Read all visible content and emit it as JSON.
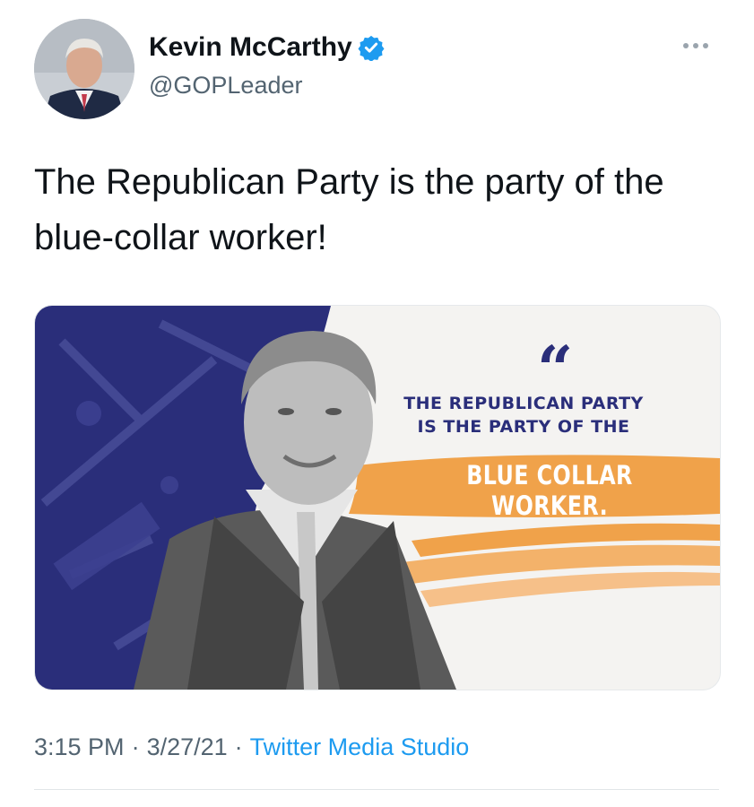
{
  "author": {
    "name": "Kevin McCarthy",
    "handle": "@GOPLeader",
    "verified_icon": "verified-badge-icon",
    "avatar_icon": "avatar-portrait"
  },
  "more_icon": "more-options-icon",
  "tweet": {
    "text": "The Republican Party is the party of the blue-collar worker!"
  },
  "media": {
    "quote_mark": "“",
    "line1": "THE REPUBLICAN PARTY",
    "line2": "IS THE PARTY OF THE",
    "highlight": "BLUE COLLAR WORKER.",
    "colors": {
      "navy": "#2a2e7a",
      "orange": "#f0a24a",
      "background": "#f4f3f1"
    }
  },
  "meta": {
    "time": "3:15 PM",
    "sep1": "·",
    "date": "3/27/21",
    "sep2": "·",
    "source": "Twitter Media Studio"
  },
  "colors": {
    "link": "#1d9bf0",
    "secondary": "#536471",
    "verified": "#1d9bf0"
  }
}
